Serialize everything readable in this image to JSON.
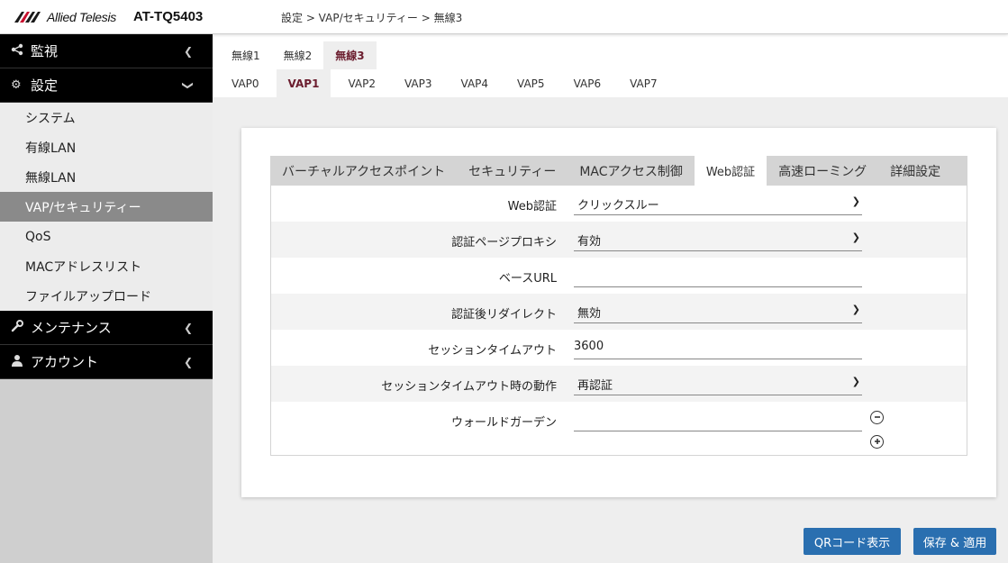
{
  "header": {
    "brand": "Allied Telesis",
    "model": "AT-TQ5403",
    "breadcrumb": "設定 > VAP/セキュリティー > 無線3"
  },
  "sidebar": {
    "groups": [
      {
        "label": "監視",
        "icon": "share-icon"
      },
      {
        "label": "設定",
        "icon": "gear-icon"
      },
      {
        "label": "メンテナンス",
        "icon": "wrench-icon"
      },
      {
        "label": "アカウント",
        "icon": "user-icon"
      }
    ],
    "items": [
      "システム",
      "有線LAN",
      "無線LAN",
      "VAP/セキュリティー",
      "QoS",
      "MACアドレスリスト",
      "ファイルアップロード"
    ]
  },
  "radio_tabs": [
    "無線1",
    "無線2",
    "無線3"
  ],
  "vap_tabs": [
    "VAP0",
    "VAP1",
    "VAP2",
    "VAP3",
    "VAP4",
    "VAP5",
    "VAP6",
    "VAP7"
  ],
  "sub_tabs": [
    "バーチャルアクセスポイント",
    "セキュリティー",
    "MACアクセス制御",
    "Web認証",
    "高速ローミング",
    "詳細設定"
  ],
  "form": {
    "web_auth": {
      "label": "Web認証",
      "value": "クリックスルー"
    },
    "proxy": {
      "label": "認証ページプロキシ",
      "value": "有効"
    },
    "base_url": {
      "label": "ベースURL",
      "value": ""
    },
    "redirect": {
      "label": "認証後リダイレクト",
      "value": "無効"
    },
    "timeout": {
      "label": "セッションタイムアウト",
      "value": "3600"
    },
    "timeout_action": {
      "label": "セッションタイムアウト時の動作",
      "value": "再認証"
    },
    "walled_garden": {
      "label": "ウォールドガーデン",
      "value": ""
    }
  },
  "buttons": {
    "qr": "QRコード表示",
    "save": "保存 & 適用"
  },
  "colors": {
    "primary_button": "#2a6fb0",
    "active_tab_text": "#6b1d2e",
    "sidebar_group_bg": "#000000"
  }
}
